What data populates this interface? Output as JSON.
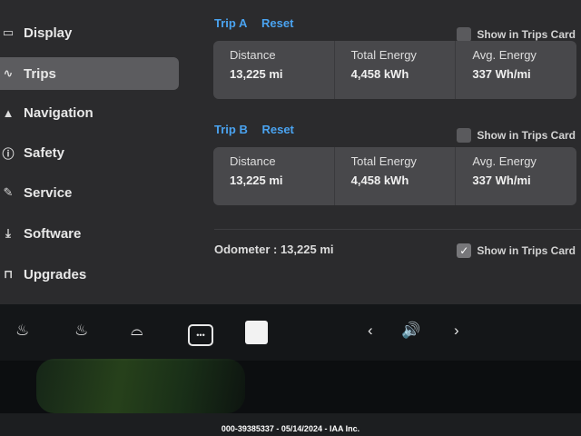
{
  "sidebar": {
    "items": [
      {
        "label": "Display",
        "icon": "display-icon",
        "glyph": "▭"
      },
      {
        "label": "Trips",
        "icon": "trips-icon",
        "glyph": "∿"
      },
      {
        "label": "Navigation",
        "icon": "navigation-icon",
        "glyph": "▲"
      },
      {
        "label": "Safety",
        "icon": "safety-icon",
        "glyph": "ⓘ"
      },
      {
        "label": "Service",
        "icon": "wrench-icon",
        "glyph": "✎"
      },
      {
        "label": "Software",
        "icon": "download-icon",
        "glyph": "⤓"
      },
      {
        "label": "Upgrades",
        "icon": "bag-icon",
        "glyph": "⊓"
      }
    ],
    "active": "Trips"
  },
  "trip_a": {
    "name": "Trip A",
    "reset": "Reset",
    "show_in_card": "Show in Trips Card",
    "checked": false,
    "stats": [
      {
        "label": "Distance",
        "value": "13,225 mi"
      },
      {
        "label": "Total Energy",
        "value": "4,458 kWh"
      },
      {
        "label": "Avg. Energy",
        "value": "337 Wh/mi"
      }
    ]
  },
  "trip_b": {
    "name": "Trip B",
    "reset": "Reset",
    "show_in_card": "Show in Trips Card",
    "checked": false,
    "stats": [
      {
        "label": "Distance",
        "value": "13,225 mi"
      },
      {
        "label": "Total Energy",
        "value": "4,458 kWh"
      },
      {
        "label": "Avg. Energy",
        "value": "337 Wh/mi"
      }
    ]
  },
  "odometer": {
    "text": "Odometer : 13,225 mi",
    "show_in_card": "Show in Trips Card",
    "checked": true,
    "check_glyph": "✓"
  },
  "taskbar": {
    "defrost_front_glyph": "♨",
    "defrost_rear_glyph": "♨",
    "wiper_glyph": "⌓",
    "more_glyph": "•••",
    "prev_glyph": "‹",
    "volume_glyph": "🔊",
    "next_glyph": "›"
  },
  "watermark": "000-39385337 - 05/14/2024 - IAA Inc.",
  "colors": {
    "accent": "#4aa3f0",
    "screen_bg": "#2b2b2d",
    "card_bg": "#48484b"
  }
}
